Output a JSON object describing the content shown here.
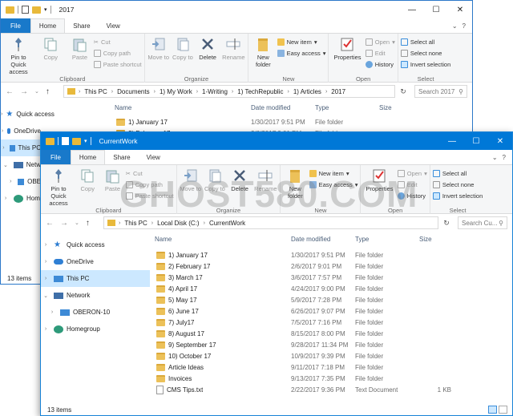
{
  "back_window": {
    "title": "2017",
    "tabs": {
      "file": "File",
      "home": "Home",
      "share": "Share",
      "view": "View"
    },
    "ribbon": {
      "clipboard": {
        "label": "Clipboard",
        "pin": "Pin to Quick access",
        "copy": "Copy",
        "paste": "Paste",
        "cut": "Cut",
        "copy_path": "Copy path",
        "paste_shortcut": "Paste shortcut"
      },
      "organize": {
        "label": "Organize",
        "move_to": "Move to",
        "copy_to": "Copy to",
        "delete": "Delete",
        "rename": "Rename"
      },
      "new": {
        "label": "New",
        "new_folder": "New folder",
        "new_item": "New item",
        "easy_access": "Easy access"
      },
      "open": {
        "label": "Open",
        "properties": "Properties",
        "open": "Open",
        "edit": "Edit",
        "history": "History"
      },
      "select": {
        "label": "Select",
        "select_all": "Select all",
        "select_none": "Select none",
        "invert": "Invert selection"
      }
    },
    "breadcrumb": [
      "This PC",
      "Documents",
      "1) My Work",
      "1-Writing",
      "1) TechRepublic",
      "1) Articles",
      "2017"
    ],
    "search_placeholder": "Search 2017",
    "nav": {
      "quick_access": "Quick access",
      "onedrive": "OneDrive",
      "this_pc": "This PC",
      "network": "Netw",
      "oberon": "OBE",
      "homegroup": "Hom"
    },
    "columns": {
      "name": "Name",
      "date": "Date modified",
      "type": "Type",
      "size": "Size"
    },
    "files": [
      {
        "name": "1) January 17",
        "date": "1/30/2017 9:51 PM",
        "type": "File folder"
      },
      {
        "name": "2) February 17",
        "date": "2/6/2017 9:01 PM",
        "type": "File folder"
      }
    ],
    "status": "13 items"
  },
  "front_window": {
    "title": "CurrentWork",
    "tabs": {
      "file": "File",
      "home": "Home",
      "share": "Share",
      "view": "View"
    },
    "ribbon": {
      "clipboard": {
        "label": "Clipboard",
        "pin": "Pin to Quick access",
        "copy": "Copy",
        "paste": "Paste",
        "cut": "Cut",
        "copy_path": "Copy path",
        "paste_shortcut": "Paste shortcut"
      },
      "organize": {
        "label": "Organize",
        "move_to": "Move to",
        "copy_to": "Copy to",
        "delete": "Delete",
        "rename": "Rename"
      },
      "new": {
        "label": "New",
        "new_folder": "New folder",
        "new_item": "New item",
        "easy_access": "Easy access"
      },
      "open": {
        "label": "Open",
        "properties": "Properties",
        "open": "Open",
        "edit": "Edit",
        "history": "History"
      },
      "select": {
        "label": "Select",
        "select_all": "Select all",
        "select_none": "Select none",
        "invert": "Invert selection"
      }
    },
    "breadcrumb": [
      "This PC",
      "Local Disk (C:)",
      "CurrentWork"
    ],
    "search_placeholder": "Search Cu...",
    "nav": {
      "quick_access": "Quick access",
      "onedrive": "OneDrive",
      "this_pc": "This PC",
      "network": "Network",
      "oberon": "OBERON-10",
      "homegroup": "Homegroup"
    },
    "columns": {
      "name": "Name",
      "date": "Date modified",
      "type": "Type",
      "size": "Size"
    },
    "files": [
      {
        "name": "1) January 17",
        "date": "1/30/2017 9:51 PM",
        "type": "File folder",
        "size": "",
        "icon": "folder"
      },
      {
        "name": "2) February 17",
        "date": "2/6/2017 9:01 PM",
        "type": "File folder",
        "size": "",
        "icon": "folder"
      },
      {
        "name": "3) March 17",
        "date": "3/6/2017 7:57 PM",
        "type": "File folder",
        "size": "",
        "icon": "folder"
      },
      {
        "name": "4) April 17",
        "date": "4/24/2017 9:00 PM",
        "type": "File folder",
        "size": "",
        "icon": "folder"
      },
      {
        "name": "5) May 17",
        "date": "5/9/2017 7:28 PM",
        "type": "File folder",
        "size": "",
        "icon": "folder"
      },
      {
        "name": "6) June 17",
        "date": "6/26/2017 9:07 PM",
        "type": "File folder",
        "size": "",
        "icon": "folder"
      },
      {
        "name": "7) July17",
        "date": "7/5/2017 7:16 PM",
        "type": "File folder",
        "size": "",
        "icon": "folder"
      },
      {
        "name": "8) August 17",
        "date": "8/15/2017 8:00 PM",
        "type": "File folder",
        "size": "",
        "icon": "folder"
      },
      {
        "name": "9) September 17",
        "date": "9/28/2017 11:34 PM",
        "type": "File folder",
        "size": "",
        "icon": "folder"
      },
      {
        "name": "10) October 17",
        "date": "10/9/2017 9:39 PM",
        "type": "File folder",
        "size": "",
        "icon": "folder"
      },
      {
        "name": "Article Ideas",
        "date": "9/11/2017 7:18 PM",
        "type": "File folder",
        "size": "",
        "icon": "folder"
      },
      {
        "name": "Invoices",
        "date": "9/13/2017 7:35 PM",
        "type": "File folder",
        "size": "",
        "icon": "folder"
      },
      {
        "name": "CMS Tips.txt",
        "date": "2/22/2017 9:36 PM",
        "type": "Text Document",
        "size": "1 KB",
        "icon": "text-file"
      }
    ],
    "status": "13 items"
  },
  "watermark": "GHOST580.COM",
  "colors": {
    "accent": "#0078d7",
    "file_tab": "#1979ca",
    "selection": "#cce8ff",
    "folder": "#ecc159"
  }
}
